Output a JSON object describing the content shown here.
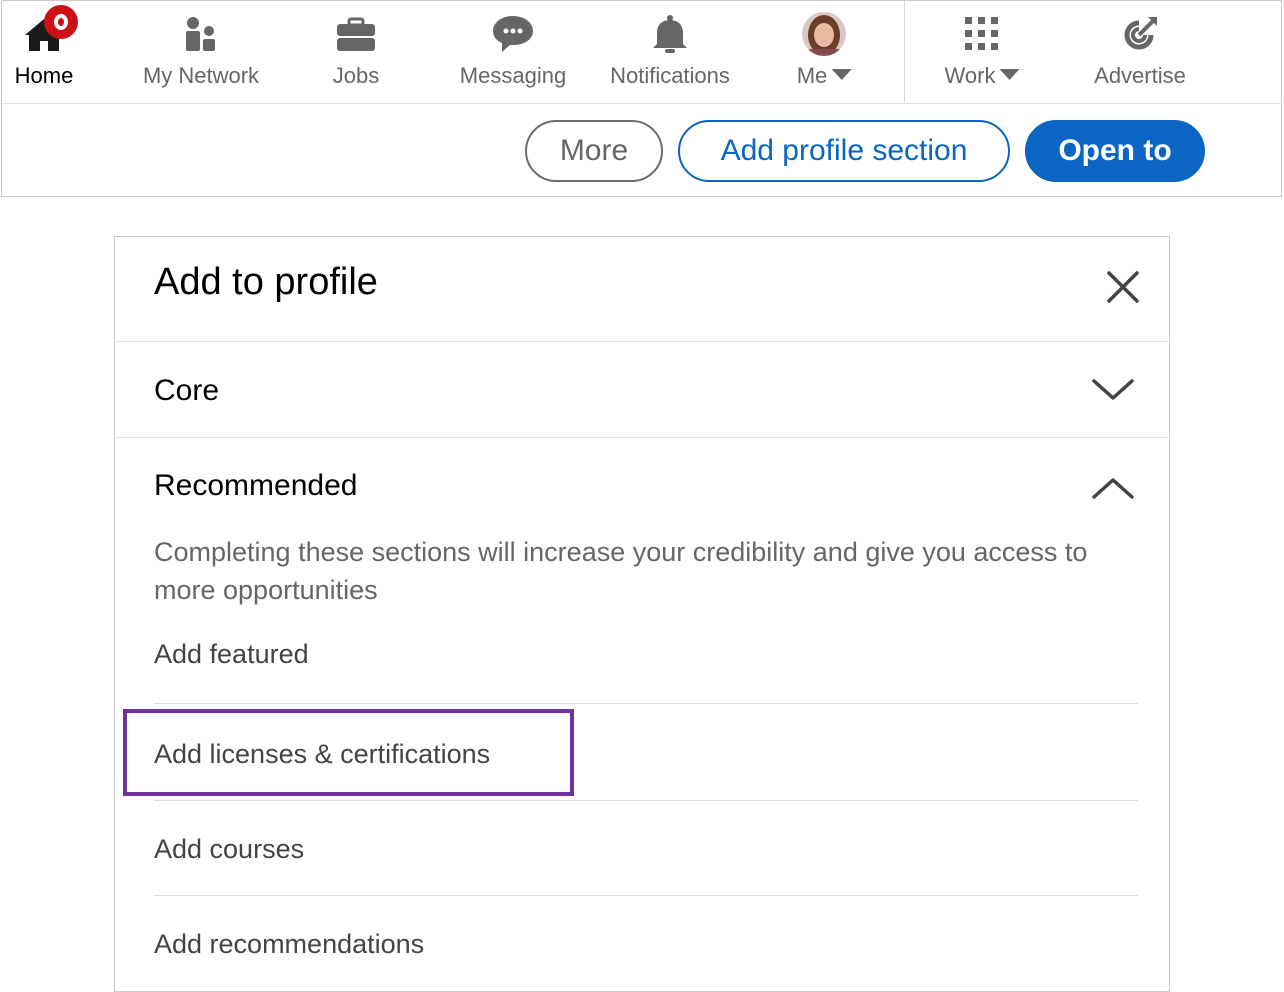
{
  "nav": {
    "items": [
      {
        "label": "Home",
        "icon": "home-icon"
      },
      {
        "label": "My Network",
        "icon": "network-icon"
      },
      {
        "label": "Jobs",
        "icon": "briefcase-icon"
      },
      {
        "label": "Messaging",
        "icon": "chat-icon"
      },
      {
        "label": "Notifications",
        "icon": "bell-icon"
      },
      {
        "label": "Me",
        "icon": "avatar"
      },
      {
        "label": "Work",
        "icon": "grid-icon"
      },
      {
        "label": "Advertise",
        "icon": "advertise-icon"
      }
    ],
    "active": "Home"
  },
  "profile_actions": {
    "more": "More",
    "add_section": "Add profile section",
    "open_to": "Open to"
  },
  "modal": {
    "title": "Add to profile",
    "sections": {
      "core": "Core",
      "recommended": "Recommended"
    },
    "recommended_desc": "Completing these sections will increase your credibility and give you access to more opportunities",
    "items": [
      "Add featured",
      "Add licenses & certifications",
      "Add courses",
      "Add recommendations"
    ],
    "highlighted_item": "Add licenses & certifications"
  },
  "colors": {
    "brand_blue": "#0a66c2",
    "highlight_purple": "#7030a0",
    "notification_red": "#cc1016"
  }
}
